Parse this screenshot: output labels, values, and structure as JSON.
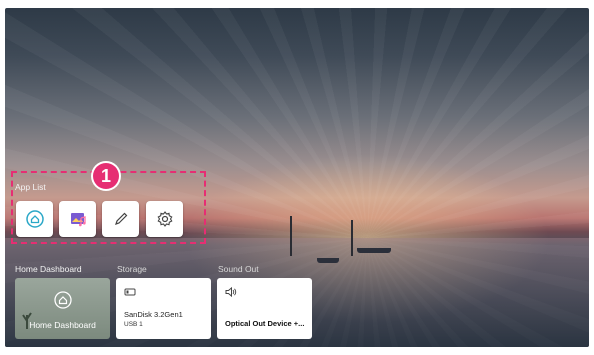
{
  "app_list": {
    "label": "App List",
    "badge": "1",
    "apps": [
      {
        "icon": "home-dashboard-icon"
      },
      {
        "icon": "media-icon"
      },
      {
        "icon": "edit-pencil-icon"
      },
      {
        "icon": "settings-gear-icon"
      }
    ]
  },
  "sections": {
    "home_dashboard": "Home Dashboard",
    "storage": "Storage",
    "sound_out": "Sound Out"
  },
  "cards": {
    "home_dashboard": {
      "label": "Home Dashboard"
    },
    "storage": {
      "name": "SanDisk 3.2Gen1",
      "sub": "USB 1"
    },
    "sound_out": {
      "name": "Optical Out Device +..."
    }
  },
  "colors": {
    "highlight": "#e62e73",
    "tile": "#ffffff"
  }
}
